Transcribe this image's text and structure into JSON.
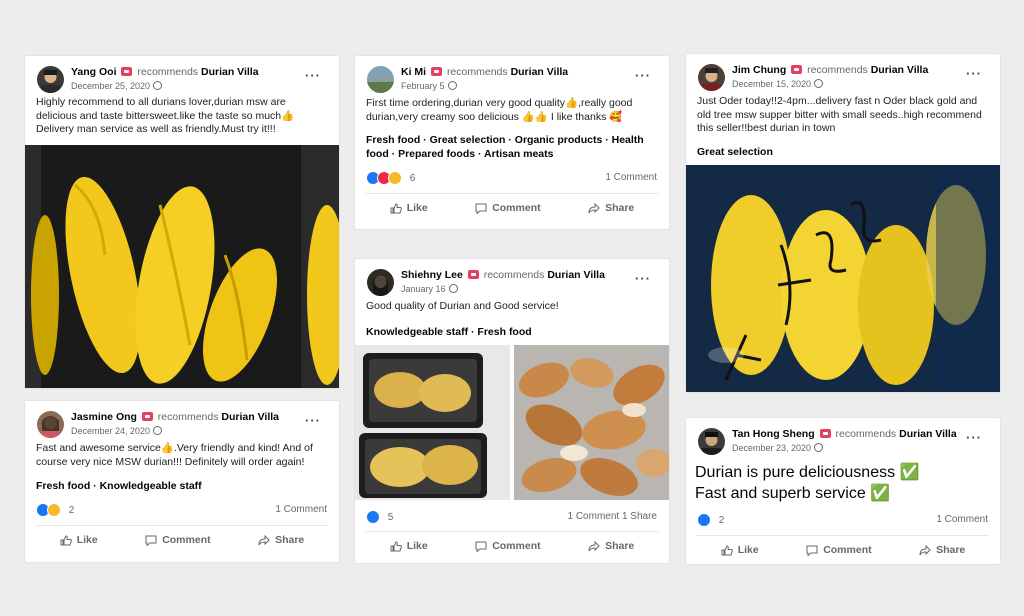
{
  "labels": {
    "recommends": "recommends",
    "like": "Like",
    "comment": "Comment",
    "share": "Share",
    "dots": "···"
  },
  "colors": {
    "background": "#ededed",
    "link_blue": "#1877f2",
    "durian_yellow": "#f2c81c",
    "badge_red": "#e4405f"
  },
  "posts": [
    {
      "name": "Yang Ooi",
      "page": "Durian Villa",
      "date": "December 25, 2020",
      "text": "Highly recommend to all durians lover,durian msw are delicious and taste bittersweet.like the taste so much👍 Delivery man service as well as friendly.Must try it!!!"
    },
    {
      "name": "Jasmine Ong",
      "page": "Durian Villa",
      "date": "December 24, 2020",
      "text": "Fast and awesome service👍.Very friendly and kind! And of course very nice MSW durian!!! Definitely will order again!",
      "tags": "Fresh food · Knowledgeable staff",
      "reactions": "2",
      "comments": "1 Comment"
    },
    {
      "name": "Ki Mi",
      "page": "Durian Villa",
      "date": "February 5",
      "text": "First time ordering,durian very good quality👍,really good durian,very creamy soo delicious 👍👍 I like thanks 🥰",
      "tags": "Fresh food · Great selection · Organic products · Health food · Prepared foods · Artisan meats",
      "reactions": "6",
      "comments": "1 Comment"
    },
    {
      "name": "Shiehny Lee",
      "page": "Durian Villa",
      "date": "January 16",
      "text": "Good quality of Durian and Good service!",
      "tags": "Knowledgeable staff · Fresh food",
      "reactions": "5",
      "comments": "1 Comment 1 Share"
    },
    {
      "name": "Jim Chung",
      "page": "Durian Villa",
      "date": "December 15, 2020",
      "text": "Just Oder today!!2-4pm...delivery fast n Oder black gold and old tree msw supper bitter with small seeds..high recommend this seller!!best durian in town",
      "tags": "Great selection"
    },
    {
      "name": "Tan Hong Sheng",
      "page": "Durian Villa",
      "date": "December 23, 2020",
      "text_line1": "Durian is pure deliciousness ✅",
      "text_line2": "Fast and superb service ✅",
      "reactions": "2",
      "comments": "1 Comment"
    }
  ]
}
